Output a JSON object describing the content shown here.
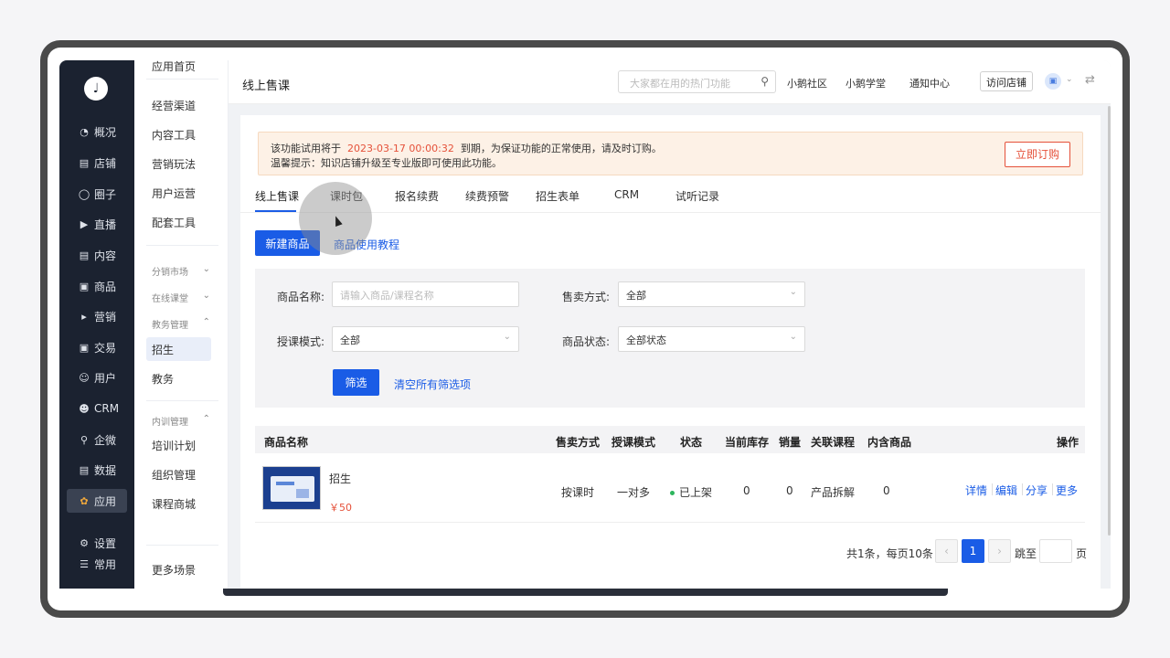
{
  "left_nav": {
    "items": [
      {
        "label": "概况",
        "icon": "pie-chart-icon"
      },
      {
        "label": "店铺",
        "icon": "store-icon"
      },
      {
        "label": "圈子",
        "icon": "group-icon"
      },
      {
        "label": "直播",
        "icon": "live-icon"
      },
      {
        "label": "内容",
        "icon": "document-icon"
      },
      {
        "label": "商品",
        "icon": "box-icon"
      },
      {
        "label": "营销",
        "icon": "megaphone-icon"
      },
      {
        "label": "交易",
        "icon": "trade-icon"
      },
      {
        "label": "用户",
        "icon": "user-icon"
      },
      {
        "label": "CRM",
        "icon": "crm-icon"
      },
      {
        "label": "企微",
        "icon": "wecom-icon"
      },
      {
        "label": "数据",
        "icon": "data-icon"
      },
      {
        "label": "应用",
        "icon": "apps-icon"
      }
    ],
    "bottom": [
      {
        "label": "设置",
        "icon": "gear-icon"
      },
      {
        "label": "常用",
        "icon": "list-icon"
      }
    ]
  },
  "sub_nav": {
    "top_item": "应用首页",
    "items": [
      "经营渠道",
      "内容工具",
      "营销玩法",
      "用户运营",
      "配套工具"
    ],
    "groups": [
      "分销市场",
      "在线课堂",
      "教务管理"
    ],
    "edu_items": [
      "招生",
      "教务"
    ],
    "training_group": "内训管理",
    "training_items": [
      "培训计划",
      "组织管理",
      "课程商城"
    ],
    "more": "更多场景"
  },
  "header": {
    "title": "线上售课",
    "search_placeholder": "大家都在用的热门功能",
    "links": [
      "小鹅社区",
      "小鹅学堂",
      "通知中心"
    ],
    "visit_store": "访问店铺"
  },
  "notice": {
    "line1_prefix": "该功能试用将于",
    "date": "2023-03-17 00:00:32",
    "line1_suffix": "到期，为保证功能的正常使用，请及时订购。",
    "line2": "温馨提示：知识店铺升级至专业版即可使用此功能。",
    "button": "立即订购"
  },
  "tabs": [
    "线上售课",
    "课时包",
    "报名续费",
    "续费预警",
    "招生表单",
    "CRM",
    "试听记录"
  ],
  "actions": {
    "new_product": "新建商品",
    "tutorial": "商品使用教程"
  },
  "filter": {
    "name_label": "商品名称:",
    "name_placeholder": "请输入商品/课程名称",
    "sale_label": "售卖方式:",
    "sale_value": "全部",
    "mode_label": "授课模式:",
    "mode_value": "全部",
    "status_label": "商品状态:",
    "status_value": "全部状态",
    "submit": "筛选",
    "clear": "清空所有筛选项"
  },
  "table": {
    "headers": [
      "商品名称",
      "售卖方式",
      "授课模式",
      "状态",
      "当前库存",
      "销量",
      "关联课程",
      "内含商品",
      "操作"
    ],
    "rows": [
      {
        "name": "招生",
        "price": "￥50",
        "sale": "按课时",
        "mode": "一对多",
        "status": "已上架",
        "stock": "0",
        "sales": "0",
        "course": "产品拆解",
        "included": "0",
        "ops": [
          "详情",
          "编辑",
          "分享",
          "更多"
        ]
      }
    ]
  },
  "pagination": {
    "summary": "共1条，每页10条",
    "current": "1",
    "jump_label": "跳至",
    "page_label": "页"
  },
  "colors": {
    "primary": "#1a5ce6",
    "warning": "#e5513a",
    "sidebar": "#1b2230",
    "status_ok": "#2db55d"
  }
}
